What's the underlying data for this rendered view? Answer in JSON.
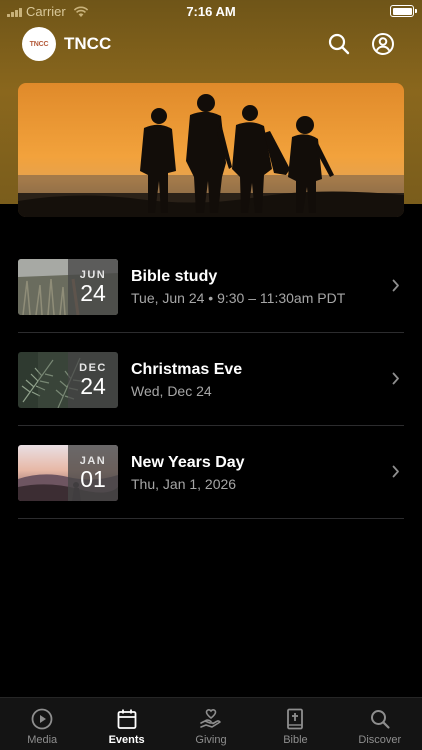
{
  "status_bar": {
    "carrier": "Carrier",
    "time": "7:16 AM"
  },
  "header": {
    "logo_text": "TNCC",
    "title": "TNCC"
  },
  "events": [
    {
      "month": "JUN",
      "day": "24",
      "title": "Bible study",
      "subtitle": "Tue, Jun 24 • 9:30 – 11:30am PDT"
    },
    {
      "month": "DEC",
      "day": "24",
      "title": "Christmas Eve",
      "subtitle": "Wed, Dec 24"
    },
    {
      "month": "JAN",
      "day": "01",
      "title": "New Years Day",
      "subtitle": "Thu, Jan 1, 2026"
    }
  ],
  "tabs": [
    {
      "label": "Media",
      "icon": "play-circle-icon"
    },
    {
      "label": "Events",
      "icon": "calendar-icon",
      "active": true
    },
    {
      "label": "Giving",
      "icon": "giving-hand-icon"
    },
    {
      "label": "Bible",
      "icon": "bible-icon"
    },
    {
      "label": "Discover",
      "icon": "search-icon"
    }
  ],
  "colors": {
    "header_gold": "#8a671d",
    "background": "#000000",
    "inactive_tab": "#8e8e8e"
  }
}
